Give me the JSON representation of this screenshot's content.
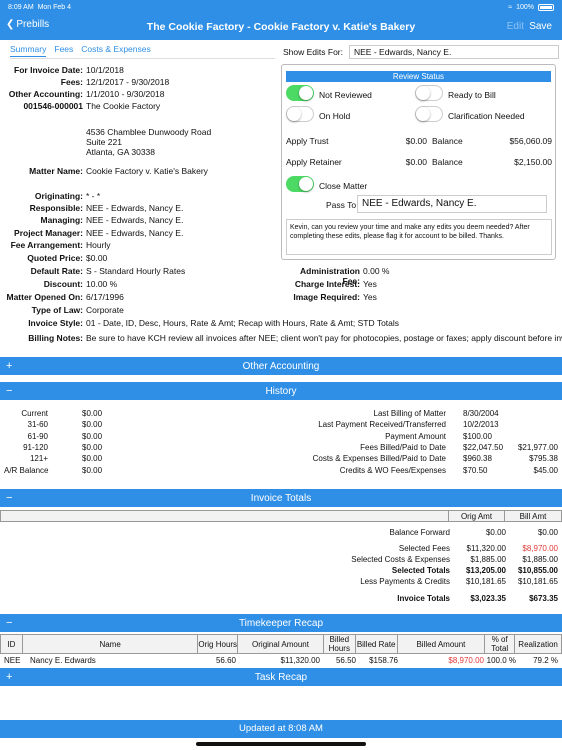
{
  "status": {
    "time": "8:09 AM",
    "date": "Mon Feb 4",
    "battery": "100%"
  },
  "nav": {
    "back_label": "Prebills",
    "title": "The Cookie Factory - Cookie Factory v. Katie's Bakery",
    "edit_label": "Edit",
    "save_label": "Save"
  },
  "tabs": [
    "Summary",
    "Fees",
    "Costs & Expenses"
  ],
  "summary": {
    "invoice_date_label": "For Invoice Date:",
    "invoice_date": "10/1/2018",
    "fees_label": "Fees:",
    "fees": "12/1/2017 - 9/30/2018",
    "other_label": "Other Accounting:",
    "other": "1/1/2010 - 9/30/2018",
    "client_no": "001546-000001",
    "client_name": "The Cookie Factory",
    "addr1": "4536 Chamblee Dunwoody Road",
    "addr2": "Suite 221",
    "addr3": "Atlanta, GA 30338",
    "matter_name_label": "Matter Name:",
    "matter_name": "Cookie Factory v. Katie's Bakery",
    "originating_label": "Originating:",
    "originating": "* - *",
    "responsible_label": "Responsible:",
    "responsible": "NEE - Edwards, Nancy E.",
    "managing_label": "Managing:",
    "managing": "NEE - Edwards, Nancy E.",
    "pm_label": "Project Manager:",
    "pm": "NEE - Edwards, Nancy E.",
    "fee_arr_label": "Fee Arrangement:",
    "fee_arr": "Hourly",
    "quoted_label": "Quoted Price:",
    "quoted": "$0.00",
    "rate_label": "Default Rate:",
    "rate": "S - Standard Hourly Rates",
    "discount_label": "Discount:",
    "discount": "10.00 %",
    "opened_label": "Matter Opened On:",
    "opened": "6/17/1996",
    "law_label": "Type of Law:",
    "law": "Corporate",
    "style_label": "Invoice Style:",
    "style": "01 - Date, ID, Desc, Hours, Rate & Amt; Recap with Hours, Rate & Amt; STD Totals",
    "notes_label": "Billing Notes:",
    "notes": "Be sure to have KCH review all invoices after NEE; client won't pay for photocopies, postage or faxes; apply discount before invoicing",
    "admin_fee_label": "Administration Fee:",
    "admin_fee": "0.00 %",
    "charge_int_label": "Charge Interest:",
    "charge_int": "Yes",
    "image_req_label": "Image Required:",
    "image_req": "Yes"
  },
  "show_edits": {
    "label": "Show Edits For:",
    "value": "NEE - Edwards, Nancy E."
  },
  "review": {
    "title": "Review Status",
    "not_reviewed": "Not Reviewed",
    "ready": "Ready to Bill",
    "on_hold": "On Hold",
    "clarification": "Clarification Needed",
    "apply_trust": "Apply Trust",
    "trust_amt": "$0.00",
    "balance_label": "Balance",
    "trust_bal": "$56,060.09",
    "apply_retainer": "Apply Retainer",
    "retainer_amt": "$0.00",
    "retainer_bal": "$2,150.00",
    "close_matter": "Close Matter",
    "pass_to_label": "Pass To",
    "pass_to": "NEE - Edwards, Nancy E.",
    "note": "Kevin, can you review your time and make any edits you deem needed? After completing these edits, please flag it for account to be billed. Thanks."
  },
  "sections": {
    "other_accounting": "Other Accounting",
    "history": "History",
    "invoice_totals": "Invoice Totals",
    "timekeeper_recap": "Timekeeper Recap",
    "task_recap": "Task Recap",
    "plus": "+",
    "minus": "−"
  },
  "history": {
    "aging": [
      {
        "label": "Current",
        "value": "$0.00"
      },
      {
        "label": "31-60",
        "value": "$0.00"
      },
      {
        "label": "61-90",
        "value": "$0.00"
      },
      {
        "label": "91-120",
        "value": "$0.00"
      },
      {
        "label": "121+",
        "value": "$0.00"
      },
      {
        "label": "A/R Balance",
        "value": "$0.00"
      }
    ],
    "right": [
      {
        "label": "Last Billing of Matter",
        "a": "8/30/2004",
        "b": ""
      },
      {
        "label": "Last Payment Received/Transferred",
        "a": "10/2/2013",
        "b": ""
      },
      {
        "label": "Payment Amount",
        "a": "$100.00",
        "b": ""
      },
      {
        "label": "Fees Billed/Paid to Date",
        "a": "$22,047.50",
        "b": "$21,977.00"
      },
      {
        "label": "Costs & Expenses Billed/Paid to Date",
        "a": "$960.38",
        "b": "$795.38"
      },
      {
        "label": "Credits & WO Fees/Expenses",
        "a": "$70.50",
        "b": "$45.00"
      }
    ]
  },
  "invoice_totals": {
    "col1": "Orig Amt",
    "col2": "Bill Amt",
    "rows": [
      {
        "label": "Balance Forward",
        "orig": "$0.00",
        "bill": "$0.00",
        "bold": false,
        "red": false
      },
      {
        "label": "Selected Fees",
        "orig": "$11,320.00",
        "bill": "$8,970.00",
        "bold": false,
        "red": true
      },
      {
        "label": "Selected Costs & Expenses",
        "orig": "$1,885.00",
        "bill": "$1,885.00",
        "bold": false,
        "red": false
      },
      {
        "label": "Selected Totals",
        "orig": "$13,205.00",
        "bill": "$10,855.00",
        "bold": true,
        "red": false
      },
      {
        "label": "Less Payments & Credits",
        "orig": "$10,181.65",
        "bill": "$10,181.65",
        "bold": false,
        "red": false
      },
      {
        "label": "Invoice Totals",
        "orig": "$3,023.35",
        "bill": "$673.35",
        "bold": true,
        "red": false
      }
    ]
  },
  "timekeeper": {
    "headers": [
      "ID",
      "Name",
      "Orig Hours",
      "Original Amount",
      "Billed Hours",
      "Billed Rate",
      "Billed Amount",
      "% of Total",
      "Realization"
    ],
    "row": [
      "NEE",
      "Nancy E. Edwards",
      "56.60",
      "$11,320.00",
      "56.50",
      "$158.76",
      "$8,970.00",
      "100.0 %",
      "79.2 %"
    ]
  },
  "footer": {
    "updated": "Updated at 8:08 AM"
  },
  "colors": {
    "accent": "#2f8fe6",
    "toggle_on": "#4cd964",
    "red": "#e23a3a"
  }
}
